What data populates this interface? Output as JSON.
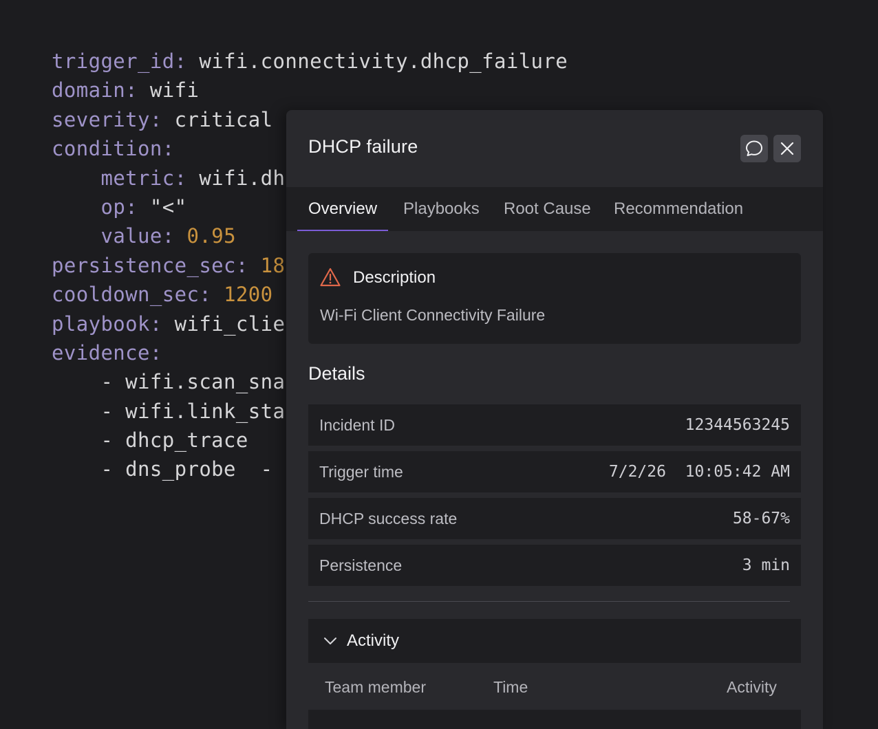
{
  "code": {
    "lines": [
      [
        {
          "c": "k",
          "t": "trigger_id"
        },
        {
          "c": "k",
          "t": ": "
        },
        {
          "c": "t",
          "t": "wifi.connectivity.dhcp_failure"
        }
      ],
      [
        {
          "c": "k",
          "t": "domain"
        },
        {
          "c": "k",
          "t": ": "
        },
        {
          "c": "t",
          "t": "wifi"
        }
      ],
      [
        {
          "c": "k",
          "t": "severity"
        },
        {
          "c": "k",
          "t": ": "
        },
        {
          "c": "t",
          "t": "critical"
        }
      ],
      [
        {
          "c": "k",
          "t": "condition"
        },
        {
          "c": "k",
          "t": ":"
        }
      ],
      [
        {
          "c": "t",
          "t": "    "
        },
        {
          "c": "k",
          "t": "metric"
        },
        {
          "c": "k",
          "t": ": "
        },
        {
          "c": "t",
          "t": "wifi.dh"
        }
      ],
      [
        {
          "c": "t",
          "t": "    "
        },
        {
          "c": "k",
          "t": "op"
        },
        {
          "c": "k",
          "t": ": "
        },
        {
          "c": "t",
          "t": "\"<\""
        }
      ],
      [
        {
          "c": "t",
          "t": "    "
        },
        {
          "c": "k",
          "t": "value"
        },
        {
          "c": "k",
          "t": ": "
        },
        {
          "c": "n",
          "t": "0.95"
        }
      ],
      [
        {
          "c": "k",
          "t": "persistence_sec"
        },
        {
          "c": "k",
          "t": ": "
        },
        {
          "c": "n",
          "t": "18"
        }
      ],
      [
        {
          "c": "k",
          "t": "cooldown_sec"
        },
        {
          "c": "k",
          "t": ": "
        },
        {
          "c": "n",
          "t": "1200"
        }
      ],
      [
        {
          "c": "k",
          "t": "playbook"
        },
        {
          "c": "k",
          "t": ": "
        },
        {
          "c": "t",
          "t": "wifi_clie"
        }
      ],
      [
        {
          "c": "k",
          "t": "evidence"
        },
        {
          "c": "k",
          "t": ":"
        }
      ],
      [
        {
          "c": "t",
          "t": "    - wifi.scan_sna"
        }
      ],
      [
        {
          "c": "t",
          "t": "    - wifi.link_sta"
        }
      ],
      [
        {
          "c": "t",
          "t": "    - dhcp_trace"
        }
      ],
      [
        {
          "c": "t",
          "t": "    - dns_probe  - h"
        }
      ]
    ]
  },
  "panel": {
    "title": "DHCP failure",
    "chat_icon": "chat-bubble-icon",
    "close_icon": "close-icon",
    "tabs": [
      {
        "label": "Overview",
        "active": true
      },
      {
        "label": "Playbooks",
        "active": false
      },
      {
        "label": "Root Cause",
        "active": false
      },
      {
        "label": "Recommendation",
        "active": false
      }
    ],
    "description": {
      "icon": "warning-triangle-icon",
      "icon_color": "#e0684a",
      "title": "Description",
      "text": "Wi-Fi Client Connectivity Failure"
    },
    "details": {
      "heading": "Details",
      "rows": [
        {
          "label": "Incident ID",
          "value": "12344563245"
        },
        {
          "label": "Trigger time",
          "value": "7/2/26  10:05:42 AM"
        },
        {
          "label": "DHCP success rate",
          "value": "58-67%"
        },
        {
          "label": "Persistence",
          "value": "3 min"
        }
      ]
    },
    "activity": {
      "title": "Activity",
      "chevron_icon": "chevron-down-icon",
      "columns": [
        "Team member",
        "Time",
        "Activity"
      ]
    }
  },
  "colors": {
    "background": "#1c1c1f",
    "panel": "#29292d",
    "accent": "#7b5cd6",
    "code_key": "#9f93c9",
    "code_number": "#c9923e"
  }
}
